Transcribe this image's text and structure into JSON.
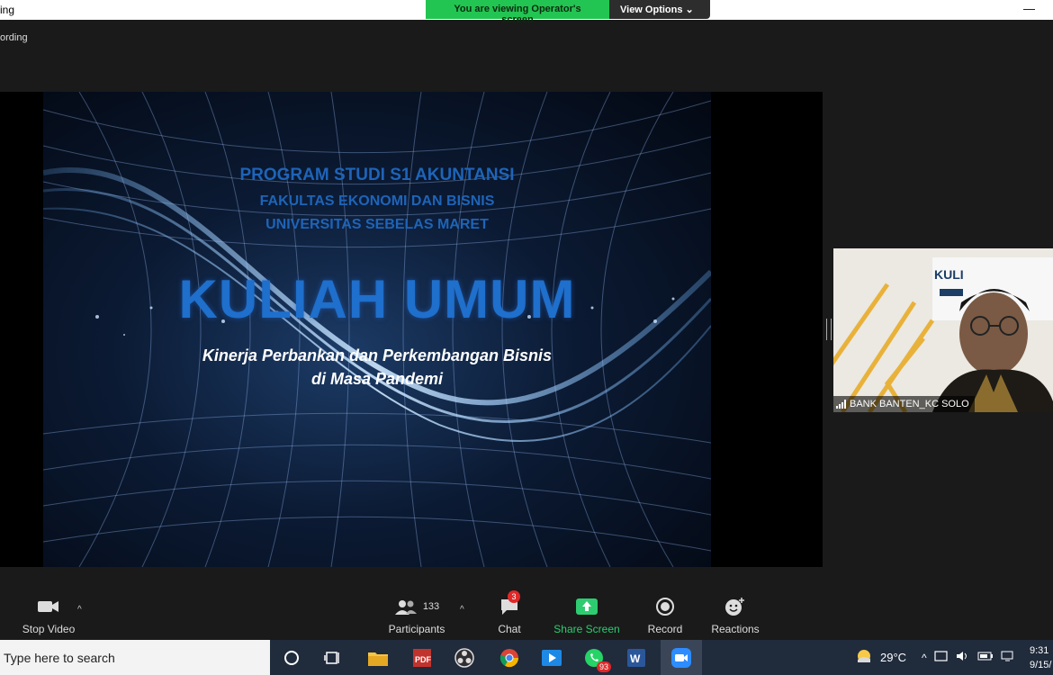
{
  "window": {
    "title": "ing",
    "recording_label": "ording",
    "viewing_banner": "You are viewing Operator's screen",
    "view_options_label": "View Options",
    "minimize_glyph": "—"
  },
  "slide": {
    "line1": "PROGRAM STUDI S1 AKUNTANSI",
    "line2": "FAKULTAS EKONOMI DAN BISNIS",
    "line3": "UNIVERSITAS SEBELAS MARET",
    "headline": "KULIAH UMUM",
    "subtitle1": "Kinerja Perbankan dan Perkembangan Bisnis",
    "subtitle2": "di Masa Pandemi"
  },
  "participant_tile": {
    "name": "BANK BANTEN_KC SOLO",
    "backdrop_text": "KULI"
  },
  "toolbar": {
    "stop_video": "Stop Video",
    "participants": "Participants",
    "participant_count": "133",
    "chat": "Chat",
    "chat_badge": "3",
    "share_screen": "Share Screen",
    "record": "Record",
    "reactions": "Reactions",
    "share_color": "#2ecc71"
  },
  "taskbar": {
    "search_placeholder": "Type here to search",
    "whatsapp_badge": "93",
    "temperature": "29°C",
    "time": "9:31",
    "date": "9/15/"
  }
}
